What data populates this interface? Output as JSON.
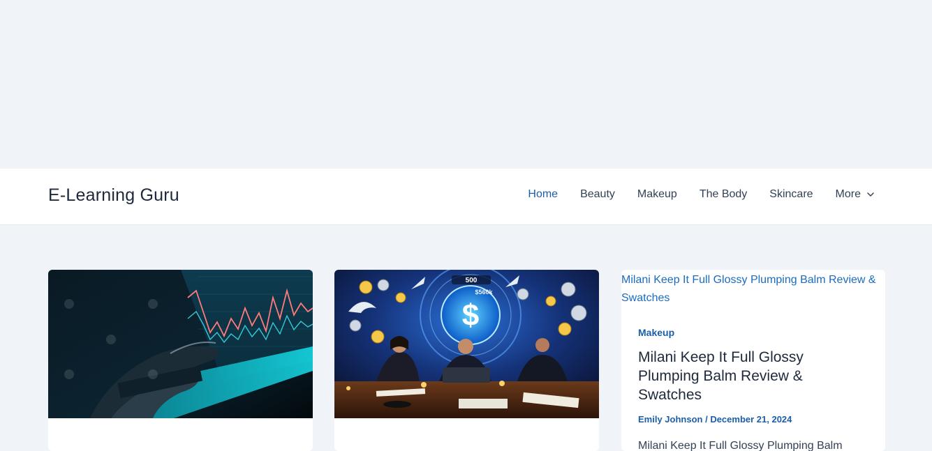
{
  "site": {
    "title": "E-Learning Guru"
  },
  "nav": {
    "items": [
      {
        "label": "Home",
        "active": true
      },
      {
        "label": "Beauty",
        "active": false
      },
      {
        "label": "Makeup",
        "active": false
      },
      {
        "label": "The Body",
        "active": false
      },
      {
        "label": "Skincare",
        "active": false
      },
      {
        "label": "More",
        "active": false,
        "has_dropdown": true
      }
    ]
  },
  "cards": [
    {
      "image_desc": "trading-chart-laptop"
    },
    {
      "image_desc": "business-money-dollar",
      "overlay_texts": [
        "500",
        "$560k"
      ]
    },
    {
      "image_alt": "Milani Keep It Full Glossy Plumping Balm Review & Swatches",
      "category": "Makeup",
      "title": "Milani Keep It Full Glossy Plumping Balm Review & Swatches",
      "author": "Emily Johnson",
      "separator": " / ",
      "date": "December 21, 2024",
      "excerpt": "Milani Keep It Full Glossy Plumping Balm"
    }
  ],
  "colors": {
    "accent": "#1b5ea9",
    "background": "#f0f4f8",
    "header_bg": "#ffffff"
  }
}
